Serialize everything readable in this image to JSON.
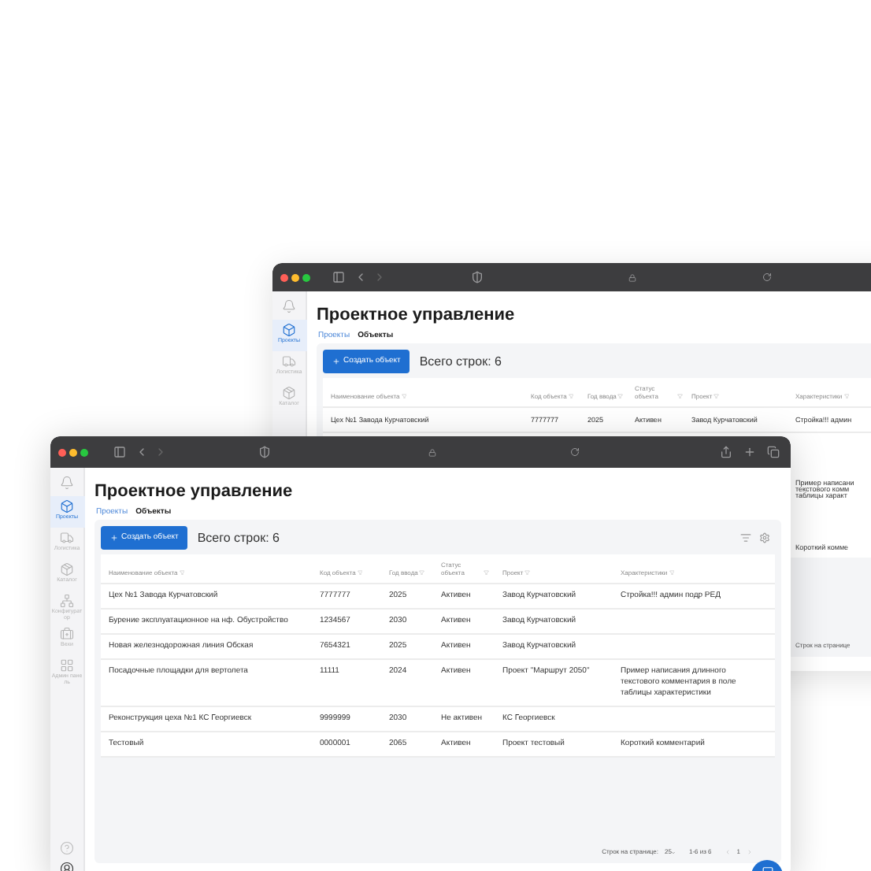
{
  "back_window": {
    "title": "Проектное управление",
    "sidebar": [
      {
        "label": "Проекты",
        "selected": true
      },
      {
        "label": "Логистика",
        "selected": false
      },
      {
        "label": "Каталог",
        "selected": false
      }
    ],
    "breadcrumbs": [
      {
        "label": "Проекты",
        "selected": false
      },
      {
        "label": "Объекты",
        "selected": true
      }
    ],
    "create_button": "Создать объект",
    "row_count": "Всего строк: 6",
    "columns": [
      "Наименование объекта",
      "Код объекта",
      "Год ввода",
      "Статус объекта",
      "Проект",
      "Характеристики"
    ],
    "rows": [
      {
        "name": "Цех №1 Завода Курчатовский",
        "code": "7777777",
        "year": "2025",
        "status": "Активен",
        "project": "Завод Курчатовский",
        "characteristics": "Стройка!!! админ"
      }
    ],
    "visible_fragments": [
      [
        "Пример написани",
        "текстового комм",
        "таблицы характ"
      ],
      [
        "Короткий комме"
      ]
    ],
    "rows_per_page_label": "Строк на странице"
  },
  "front_window": {
    "title": "Проектное управление",
    "sidebar": [
      {
        "label": "Проекты",
        "selected": true
      },
      {
        "label": "Логистика",
        "selected": false
      },
      {
        "label": "Каталог",
        "selected": false
      },
      {
        "label": "Конфигуратор",
        "selected": false
      },
      {
        "label": "Вехи",
        "selected": false
      },
      {
        "label": "Админ панель",
        "selected": false
      }
    ],
    "breadcrumbs": [
      {
        "label": "Проекты",
        "selected": false
      },
      {
        "label": "Объекты",
        "selected": true
      }
    ],
    "create_button": "Создать объект",
    "row_count": "Всего строк: 6",
    "columns": [
      "Наименование объекта",
      "Код объекта",
      "Год ввода",
      "Статус объекта",
      "Проект",
      "Характеристики"
    ],
    "rows": [
      {
        "name": "Цех №1 Завода Курчатовский",
        "code": "7777777",
        "year": "2025",
        "status": "Активен",
        "project": "Завод Курчатовский",
        "characteristics": "Стройка!!! админ подр РЕД"
      },
      {
        "name": "Бурение эксплуатационное на нф. Обустройство",
        "code": "1234567",
        "year": "2030",
        "status": "Активен",
        "project": "Завод Курчатовский"
      },
      {
        "name": "Новая железнодорожная линия Обская",
        "code": "7654321",
        "year": "2025",
        "status": "Активен",
        "project": "Завод Курчатовский"
      },
      {
        "name": "Посадочные площадки для вертолета",
        "code": "11111",
        "year": "2024",
        "status": "Активен",
        "project": "Проект \"Маршрут 2050\"",
        "characteristics": "Пример написания длинного текстового комментария в поле таблицы характеристики"
      },
      {
        "name": "Реконструкция цеха №1 КС Георгиевск",
        "code": "9999999",
        "year": "2030",
        "status": "Не активен",
        "project": "КС Георгиевск"
      },
      {
        "name": "Тестовый",
        "code": "0000001",
        "year": "2065",
        "status": "Активен",
        "project": "Проект тестовый",
        "characteristics": "Короткий комментарий"
      }
    ],
    "pagination": {
      "label": "Строк на странице:",
      "per_page": "25",
      "range": "1-6 из 6",
      "page": "1"
    }
  }
}
